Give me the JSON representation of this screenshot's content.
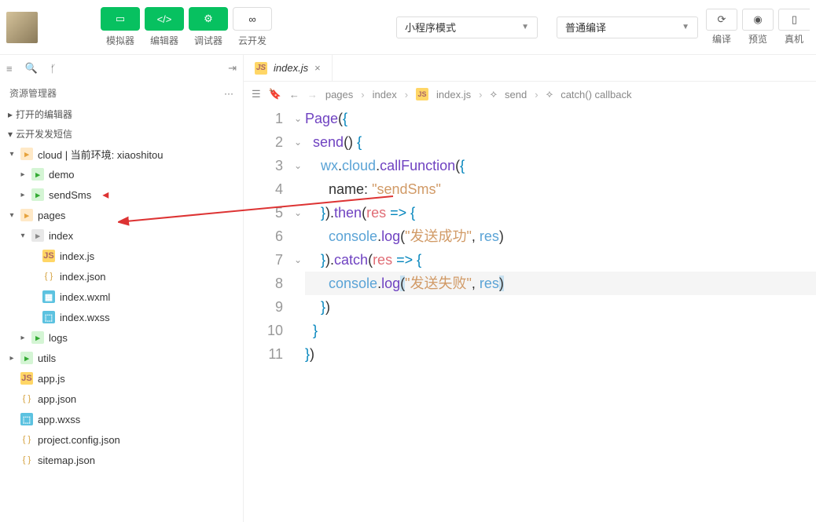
{
  "toolbar": {
    "sim_label": "模拟器",
    "editor_label": "编辑器",
    "debugger_label": "调试器",
    "cloud_label": "云开发",
    "mode_select": "小程序模式",
    "compile_select": "普通编译",
    "compile_label": "编译",
    "preview_label": "预览",
    "real_label": "真机"
  },
  "sidebar": {
    "title": "资源管理器",
    "open_editors": "打开的编辑器",
    "project_name": "云开发发短信",
    "tree": [
      {
        "label": "cloud | 当前环境: xiaoshitou"
      },
      {
        "label": "demo"
      },
      {
        "label": "sendSms"
      },
      {
        "label": "pages"
      },
      {
        "label": "index"
      },
      {
        "label": "index.js"
      },
      {
        "label": "index.json"
      },
      {
        "label": "index.wxml"
      },
      {
        "label": "index.wxss"
      },
      {
        "label": "logs"
      },
      {
        "label": "utils"
      },
      {
        "label": "app.js"
      },
      {
        "label": "app.json"
      },
      {
        "label": "app.wxss"
      },
      {
        "label": "project.config.json"
      },
      {
        "label": "sitemap.json"
      }
    ]
  },
  "editor": {
    "tab_label": "index.js",
    "breadcrumb": [
      "pages",
      "index",
      "index.js",
      "send",
      "catch() callback"
    ],
    "code": {
      "l1": {
        "fn": "Page",
        "rest": "({"
      },
      "l2": {
        "fn": "send",
        "rest": "() {"
      },
      "l3": {
        "a": "wx",
        "b": "cloud",
        "c": "callFunction",
        "rest": "({"
      },
      "l4": {
        "prop": "name",
        "str": "\"sendSms\""
      },
      "l5": {
        "a": "}).",
        "fn": "then",
        "b": "(",
        "param": "res",
        "c": " => {"
      },
      "l6": {
        "a": "console",
        "b": "log",
        "str": "\"发送成功\"",
        "param": "res"
      },
      "l7": {
        "a": "}).",
        "fn": "catch",
        "b": "(",
        "param": "res",
        "c": " => {"
      },
      "l8": {
        "a": "console",
        "b": "log",
        "str": "\"发送失败\"",
        "param": "res"
      },
      "l9": "})",
      "l10": "}",
      "l11": "})"
    }
  }
}
